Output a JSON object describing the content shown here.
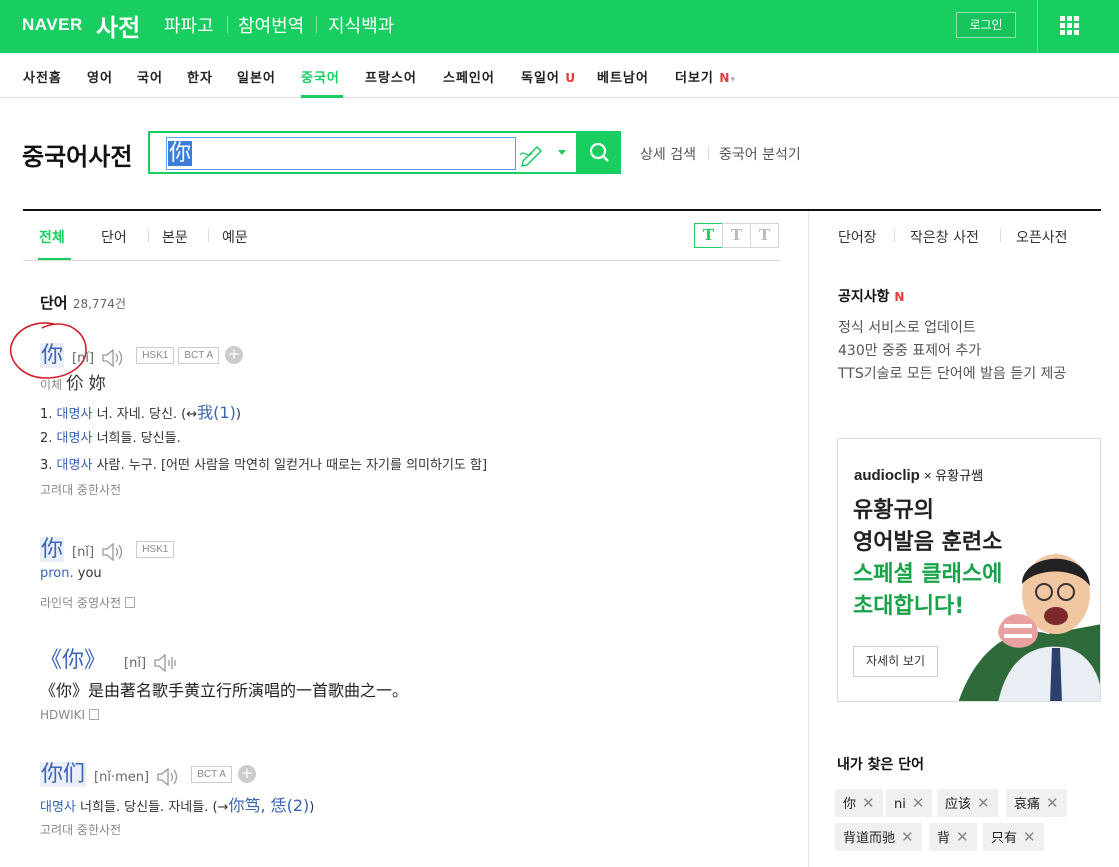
{
  "header": {
    "logo": "NAVER",
    "service": "사전",
    "gnb": [
      "파파고",
      "참여번역",
      "지식백과"
    ],
    "login": "로그인",
    "apps_icon": "grid-icon"
  },
  "langnav": {
    "items": [
      "사전홈",
      "영어",
      "국어",
      "한자",
      "일본어",
      "중국어",
      "프랑스어",
      "스페인어",
      "독일어",
      "베트남어",
      "더보기"
    ],
    "active": "중국어",
    "new_badge_1": "U",
    "new_badge_2": "N"
  },
  "search": {
    "title": "중국어사전",
    "value": "你",
    "links": [
      "상세 검색",
      "중국어 분석기"
    ]
  },
  "tabs": {
    "items": [
      "전체",
      "단어",
      "본문",
      "예문"
    ],
    "font_buttons": [
      "T",
      "T",
      "T"
    ]
  },
  "results": {
    "section": "단어",
    "count": "28,774건",
    "entry1": {
      "headword": "你",
      "pinyin": "[nǐ]",
      "tags": [
        "HSK1",
        "BCT A"
      ],
      "variant_label": "이체",
      "variants": "伱 妳",
      "senses": [
        {
          "num": "1.",
          "pos": "대명사",
          "text": "너. 자네. 당신. (↔",
          "link": "我(1)",
          "tail": ")"
        },
        {
          "num": "2.",
          "pos": "대명사",
          "text": "너희들. 당신들.",
          "link": "",
          "tail": ""
        },
        {
          "num": "3.",
          "pos": "대명사",
          "text": "사람. 누구. [어떤 사람을 막연히 일컫거나 때로는 자기를 의미하기도 함]",
          "link": "",
          "tail": ""
        }
      ],
      "source": "고려대 중한사전"
    },
    "entry2": {
      "headword": "你",
      "pinyin": "[nǐ]",
      "tags": [
        "HSK1"
      ],
      "pos": "pron.",
      "meaning": "you",
      "source": "라인덕 중영사전"
    },
    "entry3": {
      "headword": "《你》",
      "pinyin": "[nǐ]",
      "desc": "《你》是由著名歌手黄立行所演唱的一首歌曲之一。",
      "source": "HDWIKI"
    },
    "entry4": {
      "headword": "你们",
      "pinyin": "[nǐ·men]",
      "tags": [
        "BCT A"
      ],
      "pos": "대명사",
      "text": "너희들. 당신들. 자네들. (→",
      "link": "你笃, 恁(2)",
      "tail": ")",
      "source": "고려대 중한사전"
    }
  },
  "sidebar": {
    "links": [
      "단어장",
      "작은창 사전",
      "오픈사전"
    ],
    "notice_title": "공지사항",
    "notice_badge": "N",
    "notices": [
      "정식 서비스로 업데이트",
      "430만 중중 표제어 추가",
      "TTS기술로 모든 단어에 발음 듣기 제공"
    ],
    "ad": {
      "brand": "audioclip",
      "brand_x": "× 유황규쌤",
      "line1": "유황규의",
      "line2": "영어발음 훈련소",
      "line3": "스페셜 클래스에",
      "line4": "초대합니다!",
      "button": "자세히 보기"
    },
    "recent_title": "내가 찾은 단어",
    "recent": [
      "你",
      "ni",
      "应该",
      "哀痛",
      "背道而驰",
      "背",
      "只有"
    ]
  },
  "colors": {
    "brand": "#19ce60",
    "link": "#3a64b7",
    "annotation": "#d0212b"
  }
}
